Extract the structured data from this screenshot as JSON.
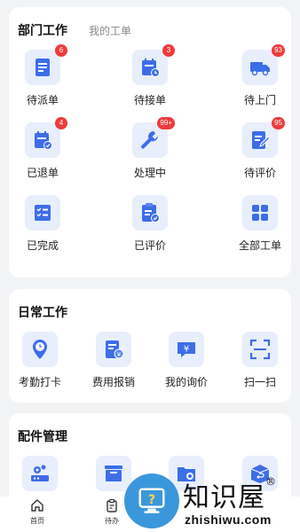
{
  "dept": {
    "title": "部门工作",
    "tab": "我的工单",
    "tiles": [
      {
        "label": "待派单",
        "icon": "dispatch-icon",
        "badge": "6"
      },
      {
        "label": "待接单",
        "icon": "calendar-clock-icon",
        "badge": "3"
      },
      {
        "label": "待上门",
        "icon": "truck-icon",
        "badge": "93"
      },
      {
        "label": "已退单",
        "icon": "calendar-return-icon",
        "badge": "4"
      },
      {
        "label": "处理中",
        "icon": "wrench-icon",
        "badge": "99+"
      },
      {
        "label": "待评价",
        "icon": "edit-doc-icon",
        "badge": "95"
      },
      {
        "label": "已完成",
        "icon": "checklist-icon"
      },
      {
        "label": "已评价",
        "icon": "clipboard-check-icon"
      },
      {
        "label": "全部工单",
        "icon": "grid-icon"
      }
    ]
  },
  "daily": {
    "title": "日常工作",
    "tiles": [
      {
        "label": "考勤打卡",
        "icon": "location-clock-icon"
      },
      {
        "label": "费用报销",
        "icon": "receipt-yen-icon"
      },
      {
        "label": "我的询价",
        "icon": "chat-yen-icon"
      },
      {
        "label": "扫一扫",
        "icon": "scan-icon"
      }
    ]
  },
  "parts": {
    "title": "配件管理",
    "tiles": [
      {
        "icon": "parts-gear-icon"
      },
      {
        "icon": "inventory-box-icon"
      },
      {
        "icon": "folder-gear-icon"
      },
      {
        "icon": "package-return-icon"
      }
    ]
  },
  "tabbar": [
    {
      "label": "首页",
      "icon": "home-icon"
    },
    {
      "label": "待办",
      "icon": "clipboard-icon"
    }
  ],
  "watermark": {
    "cn": "知识屋",
    "en": "zhishiwu.com",
    "reg": "®"
  },
  "colors": {
    "accent": "#3d6ee8",
    "icon_bg": "#e8eefc",
    "badge": "#ee3b3b"
  }
}
